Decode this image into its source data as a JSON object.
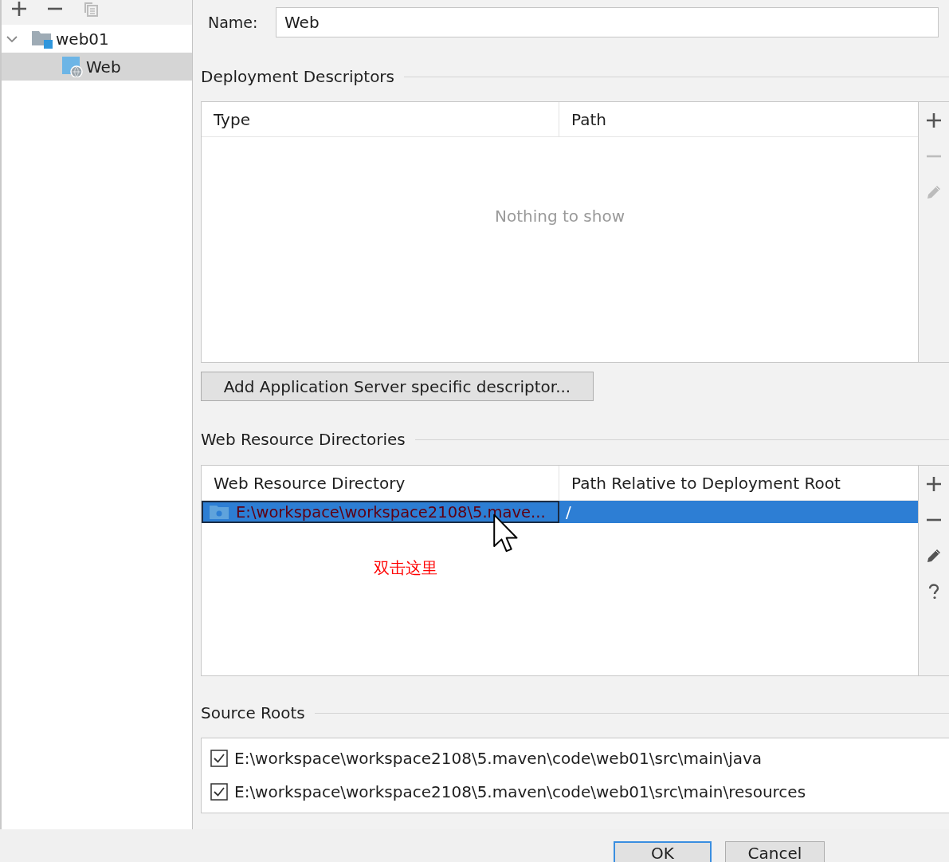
{
  "tree_toolbar": [
    {
      "kind": "add",
      "disabled": false
    },
    {
      "kind": "remove",
      "disabled": false
    },
    {
      "kind": "copy",
      "disabled": true
    }
  ],
  "tree": [
    {
      "label": "web01",
      "kind": "module",
      "expanded": true,
      "selected": false,
      "children": [
        {
          "label": "Web",
          "kind": "web_facet",
          "selected": true
        }
      ]
    }
  ],
  "name_field": {
    "label": "Name:",
    "value": "Web"
  },
  "deployment_descriptors": {
    "title": "Deployment Descriptors",
    "columns": [
      "Type",
      "Path"
    ],
    "empty_text": "Nothing to show",
    "toolbar": [
      {
        "kind": "add",
        "disabled": false
      },
      {
        "kind": "remove",
        "disabled": true
      },
      {
        "kind": "edit",
        "disabled": true
      }
    ],
    "button": "Add Application Server specific descriptor..."
  },
  "web_resource_directories": {
    "title": "Web Resource Directories",
    "columns": [
      "Web Resource Directory",
      "Path Relative to Deployment Root"
    ],
    "rows": [
      {
        "directory": "E:\\workspace\\workspace2108\\5.mave...",
        "path": "/",
        "selected": true,
        "missing": true
      }
    ],
    "toolbar": [
      {
        "kind": "add",
        "disabled": false
      },
      {
        "kind": "remove",
        "disabled": false
      },
      {
        "kind": "edit",
        "disabled": false
      },
      {
        "kind": "help",
        "disabled": false
      }
    ]
  },
  "annotation": {
    "text": "双击这里"
  },
  "source_roots": {
    "title": "Source Roots",
    "items": [
      {
        "path": "E:\\workspace\\workspace2108\\5.maven\\code\\web01\\src\\main\\java",
        "checked": true
      },
      {
        "path": "E:\\workspace\\workspace2108\\5.maven\\code\\web01\\src\\main\\resources",
        "checked": true
      }
    ]
  },
  "buttons": [
    {
      "label": "OK",
      "default": true
    },
    {
      "label": "Cancel",
      "default": false
    }
  ]
}
